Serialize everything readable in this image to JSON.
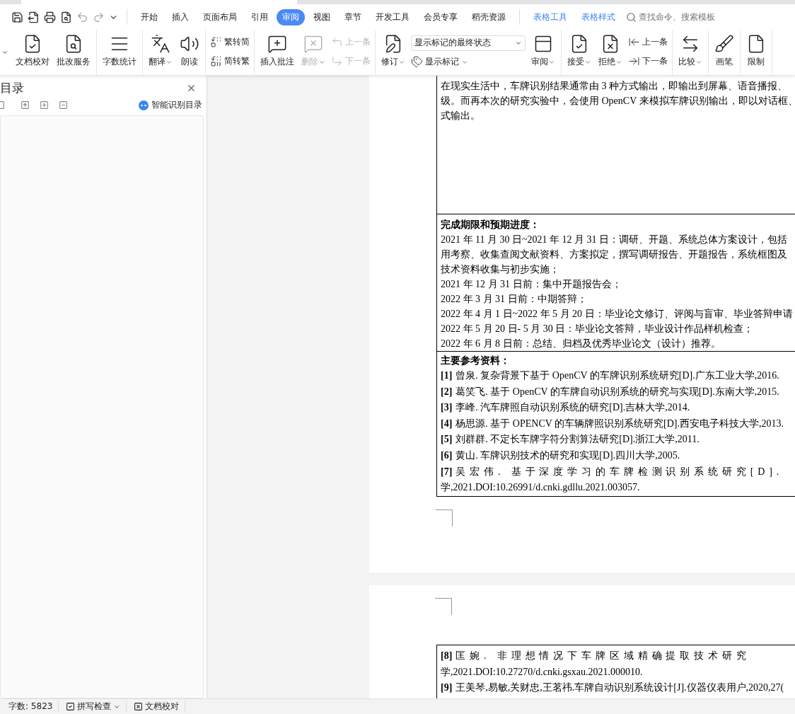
{
  "menu_tabs": [
    {
      "label": "开始",
      "selected": false,
      "kind": "main"
    },
    {
      "label": "插入",
      "selected": false,
      "kind": "main"
    },
    {
      "label": "页面布局",
      "selected": false,
      "kind": "main"
    },
    {
      "label": "引用",
      "selected": false,
      "kind": "main"
    },
    {
      "label": "审阅",
      "selected": true,
      "kind": "main"
    },
    {
      "label": "视图",
      "selected": false,
      "kind": "main"
    },
    {
      "label": "章节",
      "selected": false,
      "kind": "main"
    },
    {
      "label": "开发工具",
      "selected": false,
      "kind": "main"
    },
    {
      "label": "会员专享",
      "selected": false,
      "kind": "main"
    },
    {
      "label": "稻壳资源",
      "selected": false,
      "kind": "main"
    },
    {
      "label": "表格工具",
      "selected": false,
      "kind": "context"
    },
    {
      "label": "表格样式",
      "selected": false,
      "kind": "context"
    }
  ],
  "search": {
    "placeholder": "查找命令、搜索模板"
  },
  "ribbon": [
    {
      "items": [
        {
          "kind": "large",
          "label": "文档校对",
          "dropdown": false,
          "disabled": false
        },
        {
          "kind": "large",
          "label": "批改服务",
          "dropdown": false,
          "disabled": false
        }
      ]
    },
    {
      "items": [
        {
          "kind": "large",
          "label": "字数统计",
          "dropdown": false,
          "disabled": false
        }
      ]
    },
    {
      "items": [
        {
          "kind": "large",
          "label": "翻译",
          "dropdown": true,
          "disabled": false
        },
        {
          "kind": "large",
          "label": "朗读",
          "dropdown": false,
          "disabled": false
        }
      ]
    },
    {
      "items": [
        {
          "kind": "stack",
          "items": [
            {
              "kind": "small",
              "label": "繁转简",
              "dropdown": false,
              "disabled": false
            },
            {
              "kind": "small",
              "label": "简转繁",
              "dropdown": false,
              "disabled": false
            }
          ]
        }
      ]
    },
    {
      "items": [
        {
          "kind": "large",
          "label": "插入批注",
          "dropdown": false,
          "disabled": false
        },
        {
          "kind": "large",
          "label": "删除",
          "dropdown": true,
          "disabled": true
        },
        {
          "kind": "stack",
          "items": [
            {
              "kind": "small",
              "label": "上一条",
              "dropdown": false,
              "disabled": true
            },
            {
              "kind": "small",
              "label": "下一条",
              "dropdown": false,
              "disabled": true
            }
          ]
        }
      ]
    },
    {
      "items": [
        {
          "kind": "large",
          "label": "修订",
          "dropdown": true,
          "disabled": false
        },
        {
          "kind": "stack",
          "items": [
            {
              "kind": "select",
              "value": "显示标记的最终状态"
            },
            {
              "kind": "small",
              "label": "显示标记",
              "dropdown": true,
              "disabled": false
            }
          ]
        },
        {
          "kind": "large",
          "label": "审阅",
          "dropdown": true,
          "disabled": false
        }
      ]
    },
    {
      "items": [
        {
          "kind": "large",
          "label": "接受",
          "dropdown": true,
          "disabled": false
        },
        {
          "kind": "large",
          "label": "拒绝",
          "dropdown": true,
          "disabled": false
        },
        {
          "kind": "stack",
          "items": [
            {
              "kind": "small",
              "label": "上一条",
              "dropdown": false,
              "disabled": false
            },
            {
              "kind": "small",
              "label": "下一条",
              "dropdown": false,
              "disabled": false
            }
          ]
        }
      ]
    },
    {
      "items": [
        {
          "kind": "large",
          "label": "比较",
          "dropdown": true,
          "disabled": false
        }
      ]
    },
    {
      "items": [
        {
          "kind": "large",
          "label": "画笔",
          "dropdown": false,
          "disabled": false
        }
      ]
    },
    {
      "items": [
        {
          "kind": "large",
          "label": "限制",
          "dropdown": false,
          "disabled": false
        }
      ]
    }
  ],
  "nav_pane": {
    "title": "目录",
    "smart_button": "智能识别目录"
  },
  "page_1": {
    "cells": [
      {
        "lines": [
          "在现实生活中，车牌识别结果通常由 3 种方式输出，即输出到屏幕、语音播报、",
          "级。而再本次的研究实验中，会使用 OpenCV 来模拟车牌识别输出，即以对话框、",
          "式输出。"
        ]
      },
      {
        "heading": "完成期限和预期进度：",
        "lines": [
          "2021 年 11 月 30 日~2021 年 12 月 31 日：调研、开题、系统总体方案设计，包括",
          "用考察、收集查阅文献资料、方案拟定，撰写调研报告、开题报告，系统框图及",
          "技术资料收集与初步实施；",
          "2021 年 12 月 31 日前：集中开题报告会；",
          "2022 年 3 月 31 日前：中期答辩；",
          "2022 年 4 月 1 日~2022 年 5 月 20 日：毕业论文修订、评阅与盲审、毕业答辩申请",
          "2022 年 5 月 20 日- 5 月 30 日：毕业论文答辩，毕业设计作品样机检查；",
          "2022 年 6 月 8 日前：总结、归档及优秀毕业论文（设计）推荐。"
        ]
      },
      {
        "heading": "主要参考资料：",
        "refs": [
          {
            "number": "[1]",
            "text": "曾泉. 复杂背景下基于 OpenCV 的车牌识别系统研究[D].广东工业大学,2016.",
            "spread": false
          },
          {
            "number": "[2]",
            "text": "葛笑飞. 基于 OpenCV 的车牌自动识别系统的研究与实现[D].东南大学,2015.",
            "spread": false
          },
          {
            "number": "[3]",
            "text": "李峰. 汽车牌照自动识别系统的研究[D].吉林大学,2014.",
            "spread": false
          },
          {
            "number": "[4]",
            "text": "杨思源. 基于 OPENCV 的车辆牌照识别系统研究[D].西安电子科技大学,2013.",
            "spread": false
          },
          {
            "number": "[5]",
            "text": "刘群群. 不定长车牌字符分割算法研究[D].浙江大学,2011.",
            "spread": false
          },
          {
            "number": "[6]",
            "text": "黄山. 车牌识别技术的研究和实现[D].四川大学,2005.",
            "spread": false
          },
          {
            "number": "[7]",
            "text": "吴宏伟. 基于深度学习的车牌检测识别系统研究[D].",
            "spread": true,
            "continuation": "学,2021.DOI:10.26991/d.cnki.gdllu.2021.003057."
          }
        ]
      }
    ]
  },
  "page_2": {
    "refs": [
      {
        "number": "[8]",
        "text": "匡婉. 非理想情况下车牌区域精确提取技术研究",
        "spread": true,
        "continuation": "学,2021.DOI:10.27270/d.cnki.gsxau.2021.000010."
      },
      {
        "number": "[9]",
        "text": "王美琴,易敏,关财忠,王茗祎.车牌自动识别系统设计[J].仪器仪表用户,2020,27(",
        "spread": false
      }
    ]
  },
  "status_bar": [
    {
      "kind": "text",
      "label": "字数: 5823",
      "dropdown": false
    },
    {
      "kind": "check",
      "label": "拼写检查",
      "dropdown": true
    },
    {
      "kind": "proof",
      "label": "文档校对",
      "dropdown": false
    }
  ]
}
